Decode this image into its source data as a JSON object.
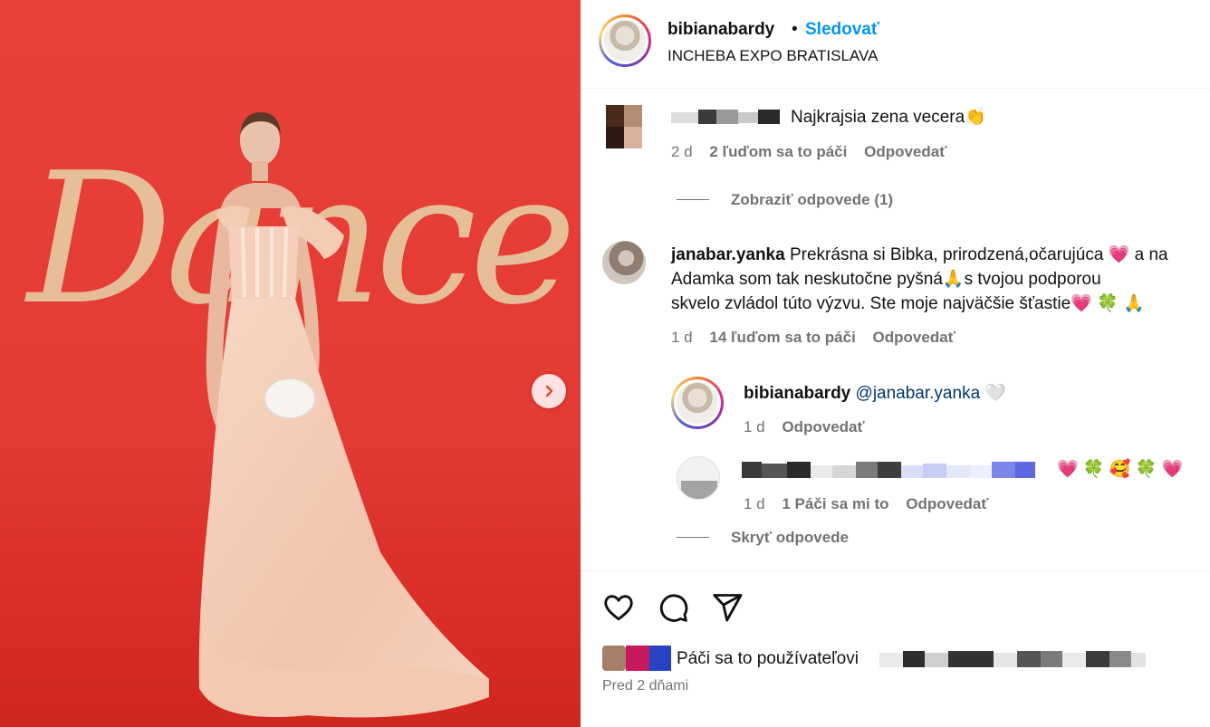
{
  "post": {
    "username": "bibianabardy",
    "separator": "•",
    "follow_label": "Sledovať",
    "location": "INCHEBA EXPO BRATISLAVA",
    "backdrop_text": "Dance"
  },
  "comments": [
    {
      "username": "",
      "text": "Najkrajsia zena vecera👏",
      "time": "2 d",
      "likes": "2 ľuďom sa to páči",
      "reply_label": "Odpovedať",
      "view_replies": "Zobraziť odpovede (1)"
    },
    {
      "username": "janabar.yanka",
      "text_line1": "Prekrásna si Bibka, prirodzená,očarujúca 💗 a na",
      "text_line2": "Adamka som tak neskutočne pyšná🙏s tvojou podporou",
      "text_line3": "skvelo zvládol túto výzvu. Ste moje najväčšie šťastie💗 🍀 🙏",
      "time": "1 d",
      "likes": "14 ľuďom sa to páči",
      "reply_label": "Odpovedať",
      "replies": [
        {
          "username": "bibianabardy",
          "mention": "@janabar.yanka",
          "emoji": "🤍",
          "time": "1 d",
          "reply_label": "Odpovedať"
        },
        {
          "emoji": "💗 🍀 🥰 🍀 💗",
          "time": "1 d",
          "likes": "1 Páči sa mi to",
          "reply_label": "Odpovedať"
        }
      ],
      "hide_replies": "Skryť odpovede"
    }
  ],
  "footer": {
    "liked_by": "Páči sa to používateľovi",
    "date": "Pred 2 dňami"
  },
  "colors": {
    "accent": "#0095f6",
    "muted": "#737373",
    "backdrop_red": "#e43a34"
  }
}
